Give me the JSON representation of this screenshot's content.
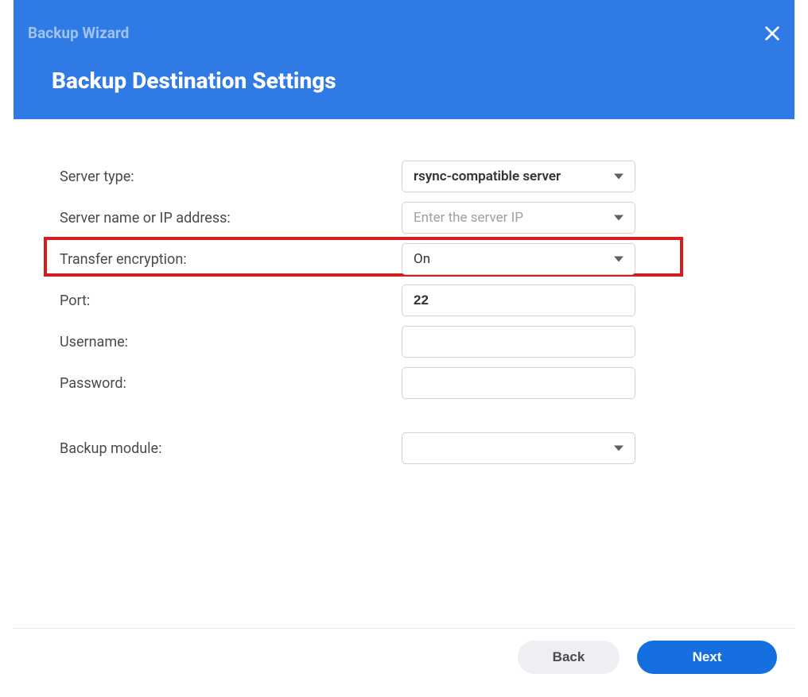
{
  "header": {
    "wizard_title": "Backup Wizard",
    "page_title": "Backup Destination Settings"
  },
  "form": {
    "server_type": {
      "label": "Server type:",
      "value": "rsync-compatible server"
    },
    "server_ip": {
      "label": "Server name or IP address:",
      "placeholder": "Enter the server IP",
      "value": ""
    },
    "encryption": {
      "label": "Transfer encryption:",
      "value": "On"
    },
    "port": {
      "label": "Port:",
      "value": "22"
    },
    "username": {
      "label": "Username:",
      "value": ""
    },
    "password": {
      "label": "Password:",
      "value": ""
    },
    "module": {
      "label": "Backup module:",
      "value": ""
    }
  },
  "buttons": {
    "back": "Back",
    "next": "Next"
  }
}
